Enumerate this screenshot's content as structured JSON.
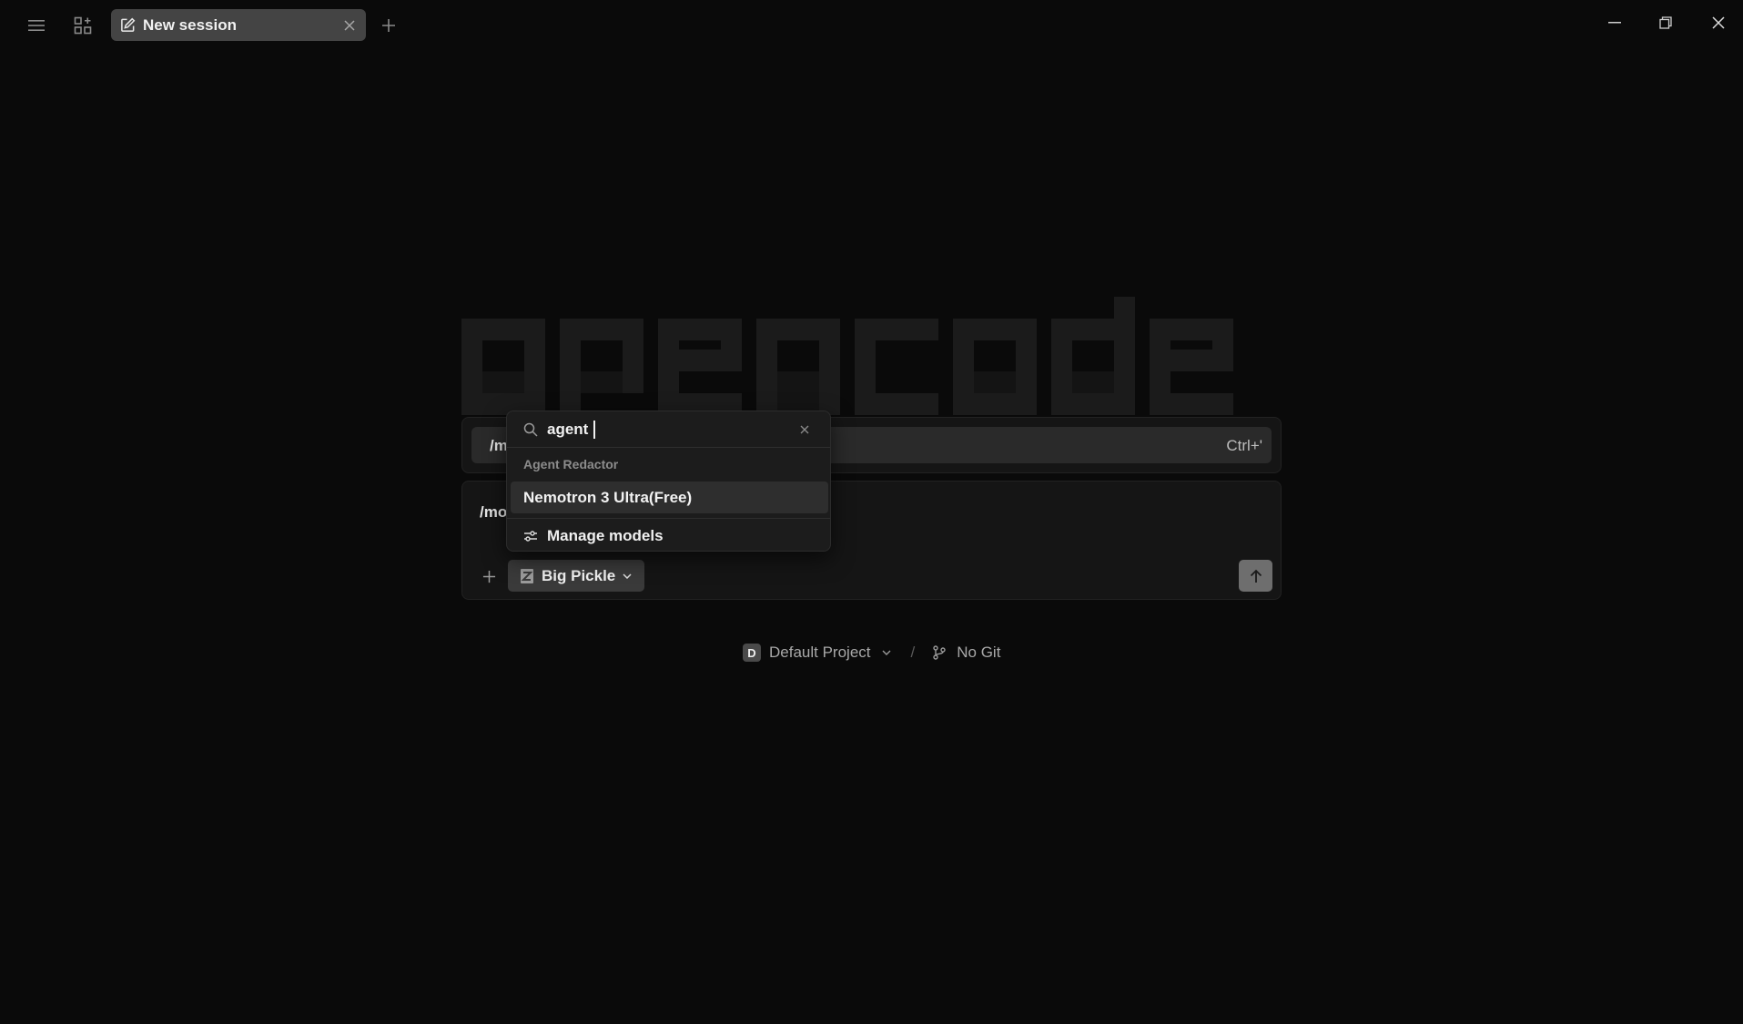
{
  "tab": {
    "title": "New session"
  },
  "logo": {
    "text": "opencode"
  },
  "command_bar": {
    "text": "/mo",
    "shortcut": "Ctrl+'"
  },
  "prompt": {
    "text": "/mo",
    "model_label": "Big Pickle"
  },
  "footer": {
    "project_initial": "D",
    "project_name": "Default Project",
    "separator": "/",
    "git_label": "No Git"
  },
  "dropdown": {
    "search_value": "agent",
    "group_label": "Agent Redactor",
    "items": [
      {
        "label": "Nemotron 3 Ultra(Free)"
      }
    ],
    "manage_label": "Manage models"
  },
  "colors": {
    "background": "#0a0a0a",
    "tab": "#444444",
    "logo": "#1b1b1b",
    "send_button": "#6e6e6e"
  }
}
